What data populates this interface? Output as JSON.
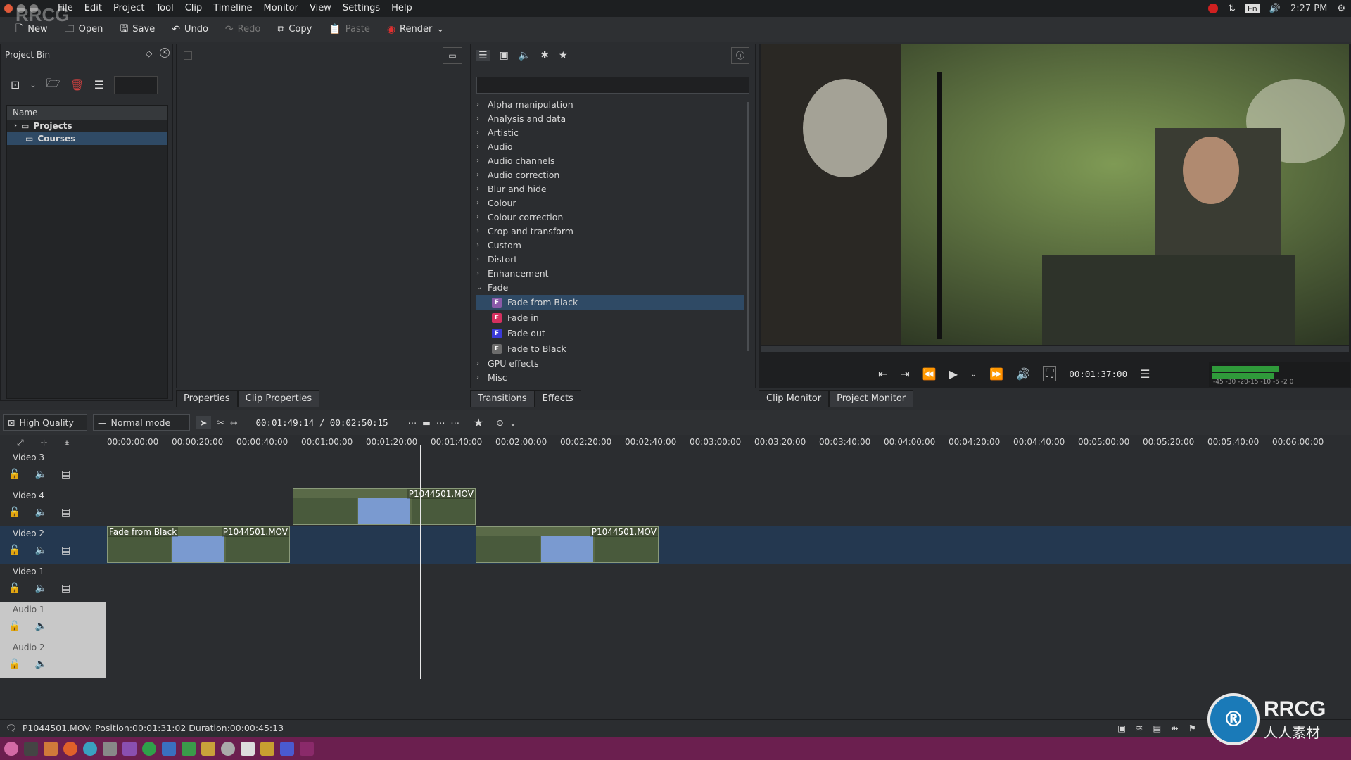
{
  "menubar": {
    "items": [
      "File",
      "Edit",
      "Project",
      "Tool",
      "Clip",
      "Timeline",
      "Monitor",
      "View",
      "Settings",
      "Help"
    ],
    "clock": "2:27 PM",
    "lang": "En"
  },
  "toolbar": {
    "new": "New",
    "open": "Open",
    "save": "Save",
    "undo": "Undo",
    "redo": "Redo",
    "copy": "Copy",
    "paste": "Paste",
    "render": "Render"
  },
  "bin": {
    "title": "Project Bin",
    "header": "Name",
    "rows": [
      "Projects",
      "Courses"
    ]
  },
  "effects": {
    "categories_top": [
      "Alpha manipulation",
      "Analysis and data",
      "Artistic",
      "Audio",
      "Audio channels",
      "Audio correction",
      "Blur and hide",
      "Colour",
      "Colour correction",
      "Crop and transform",
      "Custom",
      "Distort",
      "Enhancement",
      "Fade"
    ],
    "fade_items": [
      {
        "label": "Fade from Black",
        "badge": "F",
        "color": "#8a5aa8"
      },
      {
        "label": "Fade in",
        "badge": "F",
        "color": "#d6305f"
      },
      {
        "label": "Fade out",
        "badge": "F",
        "color": "#3a3ad8"
      },
      {
        "label": "Fade to Black",
        "badge": "F",
        "color": "#6c6c6c"
      }
    ],
    "categories_bottom": [
      "GPU effects",
      "Misc"
    ]
  },
  "tabs": {
    "left": [
      "Properties",
      "Clip Properties"
    ],
    "mid": [
      "Transitions",
      "Effects"
    ],
    "right": [
      "Clip Monitor",
      "Project Monitor"
    ]
  },
  "monitor": {
    "timecode": "00:01:37:00",
    "meter_labels": "-45 -30 -20-15 -10 -5 -2 0"
  },
  "timeline": {
    "quality": "High Quality",
    "mode": "Normal mode",
    "timecode": "00:01:49:14 / 00:02:50:15",
    "ruler": [
      "00:00:00:00",
      "00:00:20:00",
      "00:00:40:00",
      "00:01:00:00",
      "00:01:20:00",
      "00:01:40:00",
      "00:02:00:00",
      "00:02:20:00",
      "00:02:40:00",
      "00:03:00:00",
      "00:03:20:00",
      "00:03:40:00",
      "00:04:00:00",
      "00:04:20:00",
      "00:04:40:00",
      "00:05:00:00",
      "00:05:20:00",
      "00:05:40:00",
      "00:06:00:00"
    ],
    "tracks": [
      "Video 3",
      "Video 4",
      "Video 2",
      "Video 1",
      "Audio 1",
      "Audio 2"
    ],
    "clips": {
      "v4": "P1044501.MOV",
      "v2a_fx": "Fade from Black",
      "v2a": "P1044501.MOV",
      "v2b": "P1044501.MOV"
    }
  },
  "status": {
    "text": "P1044501.MOV: Position:00:01:31:02 Duration:00:00:45:13"
  },
  "watermark": {
    "top": "RRCG",
    "bottom": "人人素材",
    "corner": "RRCG"
  }
}
